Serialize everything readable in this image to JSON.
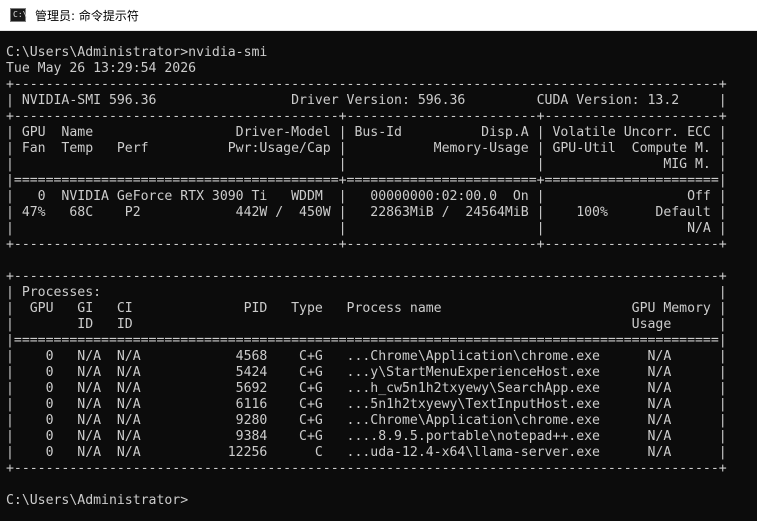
{
  "window": {
    "title": "管理员: 命令提示符",
    "icon": "cmd-prompt-icon",
    "icon_glyph": "C:\\"
  },
  "console": {
    "lines": [
      "C:\\Users\\Administrator>nvidia-smi",
      "Tue May 26 13:29:54 2026",
      "+-----------------------------------------------------------------------------------------+",
      "| NVIDIA-SMI 596.36                 Driver Version: 596.36         CUDA Version: 13.2     |",
      "+-----------------------------------------+------------------------+----------------------+",
      "| GPU  Name                  Driver-Model | Bus-Id          Disp.A | Volatile Uncorr. ECC |",
      "| Fan  Temp   Perf          Pwr:Usage/Cap |           Memory-Usage | GPU-Util  Compute M. |",
      "|                                         |                        |               MIG M. |",
      "|=========================================+========================+======================|",
      "|   0  NVIDIA GeForce RTX 3090 Ti   WDDM  |   00000000:02:00.0  On |                  Off |",
      "| 47%   68C    P2            442W /  450W |   22863MiB /  24564MiB |    100%      Default |",
      "|                                         |                        |                  N/A |",
      "+-----------------------------------------+------------------------+----------------------+",
      "",
      "+-----------------------------------------------------------------------------------------+",
      "| Processes:                                                                              |",
      "|  GPU   GI   CI              PID   Type   Process name                        GPU Memory |",
      "|        ID   ID                                                               Usage      |",
      "|=========================================================================================|",
      "|    0   N/A  N/A            4568    C+G   ...Chrome\\Application\\chrome.exe      N/A      |",
      "|    0   N/A  N/A            5424    C+G   ...y\\StartMenuExperienceHost.exe      N/A      |",
      "|    0   N/A  N/A            5692    C+G   ...h_cw5n1h2txyewy\\SearchApp.exe      N/A      |",
      "|    0   N/A  N/A            6116    C+G   ...5n1h2txyewy\\TextInputHost.exe      N/A      |",
      "|    0   N/A  N/A            9280    C+G   ...Chrome\\Application\\chrome.exe      N/A      |",
      "|    0   N/A  N/A            9384    C+G   ....8.9.5.portable\\notepad++.exe      N/A      |",
      "|    0   N/A  N/A           12256      C   ...uda-12.4-x64\\llama-server.exe      N/A      |",
      "+-----------------------------------------------------------------------------------------+",
      "",
      "C:\\Users\\Administrator>"
    ]
  },
  "colors": {
    "console_bg": "#0c0c0c",
    "console_text": "#cccccc",
    "titlebar_bg": "#ffffff"
  }
}
